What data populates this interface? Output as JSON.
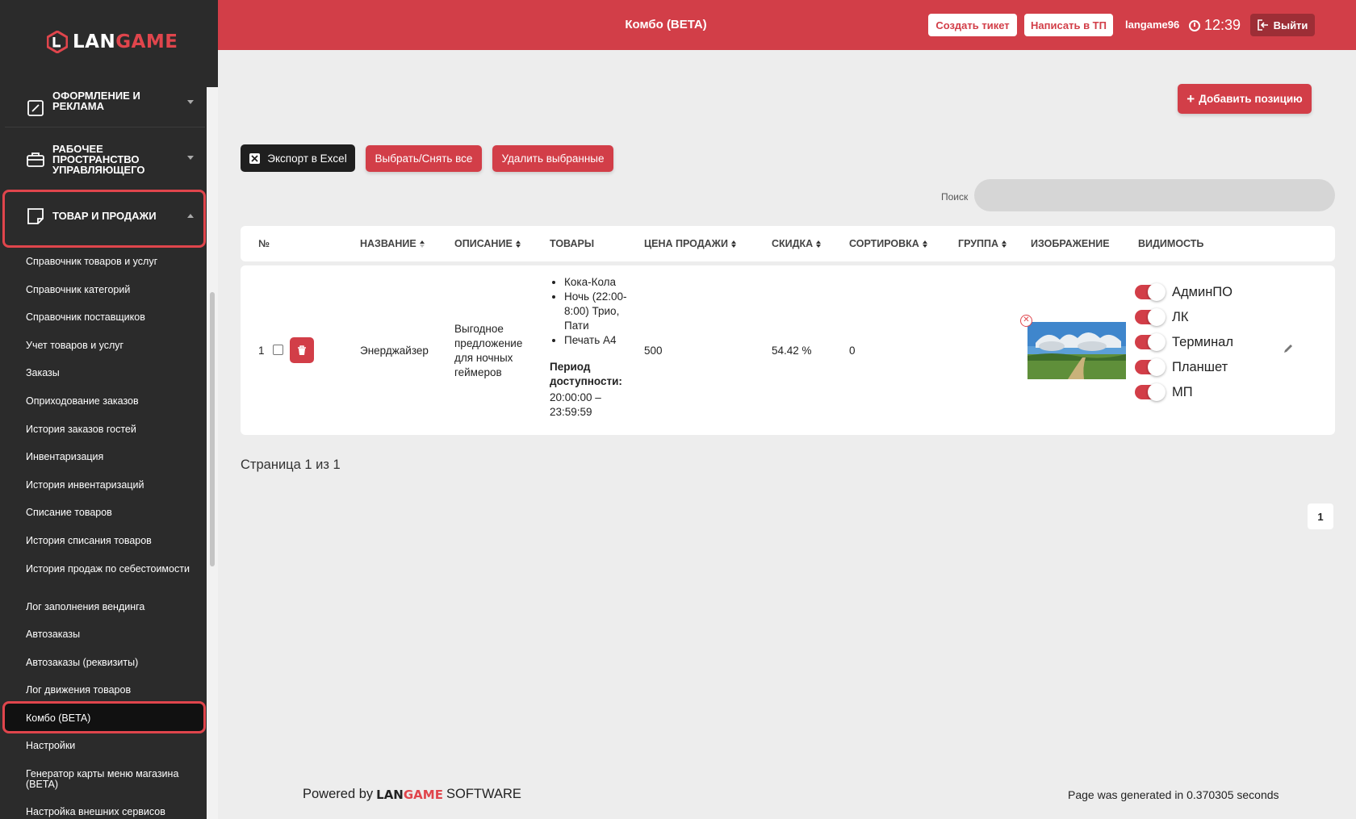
{
  "app": {
    "logo_a": "LAN",
    "logo_b": "GAME"
  },
  "header": {
    "title": "Комбо (BETA)",
    "create_ticket": "Создать тикет",
    "write_support": "Написать в ТП",
    "username": "langame96",
    "time": "12:39",
    "logout": "Выйти"
  },
  "sidebar": {
    "sections": [
      {
        "label": "ОФОРМЛЕНИЕ И РЕКЛАМА",
        "expanded": false
      },
      {
        "label": "РАБОЧЕЕ ПРОСТРАНСТВО УПРАВЛЯЮЩЕГО",
        "expanded": false
      },
      {
        "label": "ТОВАР И ПРОДАЖИ",
        "expanded": true
      }
    ],
    "items": [
      "Справочник товаров и услуг",
      "Справочник категорий",
      "Справочник поставщиков",
      "Учет товаров и услуг",
      "Заказы",
      "Оприходование заказов",
      "История заказов гостей",
      "Инвентаризация",
      "История инвентаризаций",
      "Списание товаров",
      "История списания товаров",
      "История продаж по себестоимости",
      "Лог заполнения вендинга",
      "Автозаказы",
      "Автозаказы (реквизиты)",
      "Лог движения товаров",
      "Комбо (BETA)",
      "Настройки",
      "Генератор карты меню магазина (BETA)",
      "Настройка внешних сервисов"
    ],
    "active_item": "Комбо (BETA)"
  },
  "toolbar": {
    "add_position": "Добавить позицию",
    "export_excel": "Экспорт в Excel",
    "select_all": "Выбрать/Снять все",
    "delete_selected": "Удалить выбранные",
    "search_label": "Поиск",
    "search_placeholder": ""
  },
  "table": {
    "columns": [
      "№",
      "НАЗВАНИЕ",
      "ОПИСАНИЕ",
      "ТОВАРЫ",
      "ЦЕНА ПРОДАЖИ",
      "СКИДКА",
      "СОРТИРОВКА",
      "ГРУППА",
      "ИЗОБРАЖЕНИЕ",
      "ВИДИМОСТЬ"
    ],
    "rows": [
      {
        "num": "1",
        "name": "Энерджайзер",
        "description": "Выгодное предложение для ночных геймеров",
        "goods": [
          "Кока-Кола",
          "Ночь (22:00-8:00) Трио, Пати",
          "Печать А4"
        ],
        "period_label": "Период доступности:",
        "period_value": "20:00:00 – 23:59:59",
        "price": "500",
        "discount": "54.42 %",
        "sort": "0",
        "group": "",
        "visibility": [
          {
            "label": "АдминПО",
            "on": true
          },
          {
            "label": "ЛК",
            "on": true
          },
          {
            "label": "Терминал",
            "on": true
          },
          {
            "label": "Планшет",
            "on": true
          },
          {
            "label": "МП",
            "on": true
          }
        ]
      }
    ]
  },
  "pagination": {
    "info": "Страница 1 из 1",
    "current": "1"
  },
  "footer": {
    "powered_by": "Powered by",
    "brand_a": "LAN",
    "brand_b": "GAME",
    "software": "SOFTWARE",
    "generated": "Page was generated in 0.370305 seconds"
  },
  "colors": {
    "accent": "#d23e48",
    "sidebar_bg": "#2b2b2b",
    "page_bg": "#ededed"
  }
}
